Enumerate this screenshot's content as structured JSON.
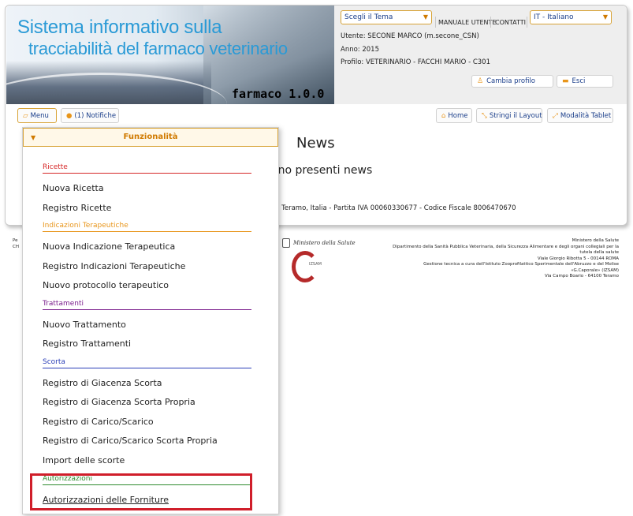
{
  "banner": {
    "title_line1": "Sistema informativo sulla",
    "title_line2": "tracciabilità del farmaco veterinario",
    "version": "farmaco 1.0.0"
  },
  "header": {
    "theme_select": "Scegli il Tema",
    "manual_link": "MANUALE UTENTE",
    "contacts_link": "CONTATTI",
    "language_select": "IT - Italiano",
    "user_line": "Utente: SECONE MARCO (m.secone_CSN)",
    "year_line": "Anno: 2015",
    "profile_line": "Profilo: VETERINARIO - FACCHI MARIO - C301",
    "change_profile_btn": "Cambia profilo",
    "logout_btn": "Esci"
  },
  "toolbar": {
    "menu_btn": "Menu",
    "notifications_btn": "(1) Notifiche",
    "home_btn": "Home",
    "narrow_layout_btn": "Stringi il Layout",
    "tablet_mode_btn": "Modalità Tablet"
  },
  "main": {
    "news_title": "News",
    "no_news_text": "ono presenti news",
    "footer_text": "0 Teramo, Italia - Partita IVA 00060330677 - Codice Fiscale 8006470670"
  },
  "bottom": {
    "left_fragment_1": "Pe",
    "left_fragment_2": "CH",
    "ministero_logo_text": "Ministero della Salute",
    "izsam_logo_text": "IZSAM",
    "right_lines": [
      "Ministero della Salute",
      "Dipartimento della Sanità Pubblica Veterinaria, della Sicurezza Alimentare e degli organi collegiali per la",
      "tutela della salute",
      "Viale Giorgio Ribotta 5 - 00144 ROMA",
      "Gestione tecnica a cura dell'Istituto Zooprofilattico Sperimentale dell'Abruzzo e del Molise",
      "«G.Caporale» (IZSAM)",
      "Via Campo Boario - 64100 Teramo"
    ]
  },
  "menu": {
    "header": "Funzionalità",
    "sections": [
      {
        "title": "Ricette",
        "color": "#d62828",
        "items": [
          "Nuova Ricetta",
          "Registro Ricette"
        ]
      },
      {
        "title": "Indicazioni Terapeutiche",
        "color": "#e8951a",
        "items": [
          "Nuova Indicazione Terapeutica",
          "Registro Indicazioni Terapeutiche",
          "Nuovo protocollo terapeutico"
        ]
      },
      {
        "title": "Trattamenti",
        "color": "#7a1d8c",
        "items": [
          "Nuovo Trattamento",
          "Registro Trattamenti"
        ]
      },
      {
        "title": "Scorta",
        "color": "#2b3fb8",
        "items": [
          "Registro di Giacenza Scorta",
          "Registro di Giacenza Scorta Propria",
          "Registro di Carico/Scarico",
          "Registro di Carico/Scarico Scorta Propria",
          "Import delle scorte"
        ]
      },
      {
        "title": "Autorizzazioni",
        "color": "#2e8b2e",
        "items": [
          "Autorizzazioni delle Forniture"
        ]
      }
    ]
  },
  "colors": {
    "accent_orange": "#d07a00",
    "link_blue": "#1a3e8a",
    "title_blue": "#2a9ad6",
    "highlight_red": "#d01e2a"
  }
}
